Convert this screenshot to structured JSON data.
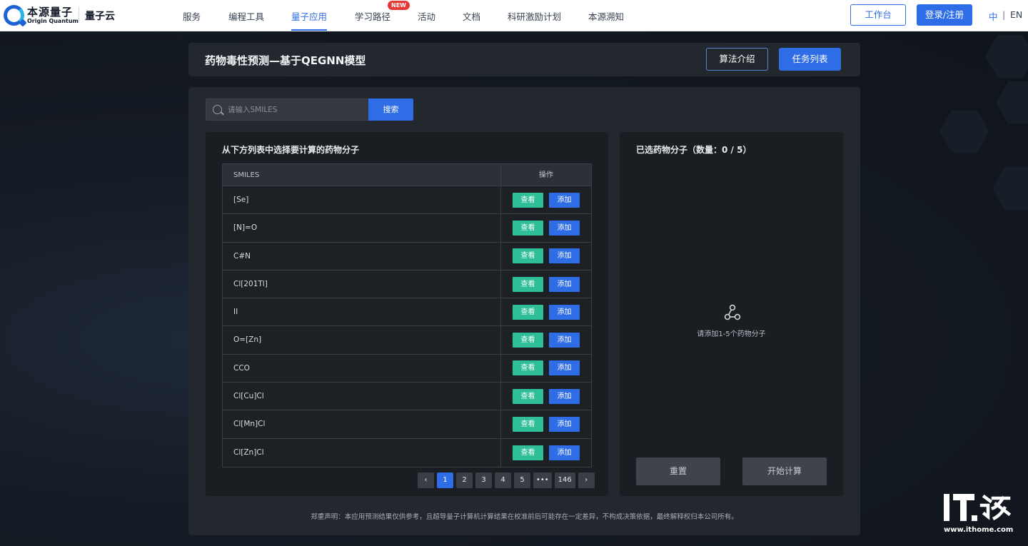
{
  "header": {
    "logo_cn": "本源量子",
    "logo_en": "Origin Quantum",
    "product": "量子云",
    "nav": [
      {
        "label": "服务"
      },
      {
        "label": "编程工具"
      },
      {
        "label": "量子应用",
        "active": true
      },
      {
        "label": "学习路径",
        "badge": "NEW"
      },
      {
        "label": "活动"
      },
      {
        "label": "文档"
      },
      {
        "label": "科研激励计划"
      },
      {
        "label": "本源溯知"
      }
    ],
    "workbench_label": "工作台",
    "login_label": "登录/注册",
    "lang_zh": "中",
    "lang_sep": "|",
    "lang_en": "EN"
  },
  "page": {
    "title": "药物毒性预测—基于QEGNN模型",
    "algo_button": "算法介绍",
    "tasks_button": "任务列表"
  },
  "search": {
    "placeholder": "请输入SMILES",
    "value": "",
    "button": "搜索"
  },
  "list": {
    "title": "从下方列表中选择要计算的药物分子",
    "columns": [
      "SMILES",
      "操作"
    ],
    "view_label": "查看",
    "add_label": "添加",
    "rows": [
      "[Se]",
      "[N]=O",
      "C#N",
      "Cl[201Tl]",
      "II",
      "O=[Zn]",
      "CCO",
      "Cl[Cu]Cl",
      "Cl[Mn]Cl",
      "Cl[Zn]Cl"
    ]
  },
  "pagination": {
    "prev": "‹",
    "pages": [
      "1",
      "2",
      "3",
      "4",
      "5"
    ],
    "ellipsis": "•••",
    "last": "146",
    "next": "›",
    "current": 1
  },
  "selected": {
    "title": "已选药物分子（数量：0 / 5）",
    "empty_text": "请添加1-5个药物分子",
    "reset_button": "重置",
    "start_button": "开始计算"
  },
  "disclaimer": "郑重声明：本应用预测结果仅供参考，且超导量子计算机计算结果在校准前后可能存在一定差异，不构成决策依据，最终解释权归本公司所有。",
  "watermark": {
    "logo_text": "IT之家",
    "url": "www.ithome.com"
  },
  "colors": {
    "accent": "#2f6de6",
    "view_green": "#2ebf96",
    "panel": "#23272e",
    "card": "#1a1d22"
  }
}
